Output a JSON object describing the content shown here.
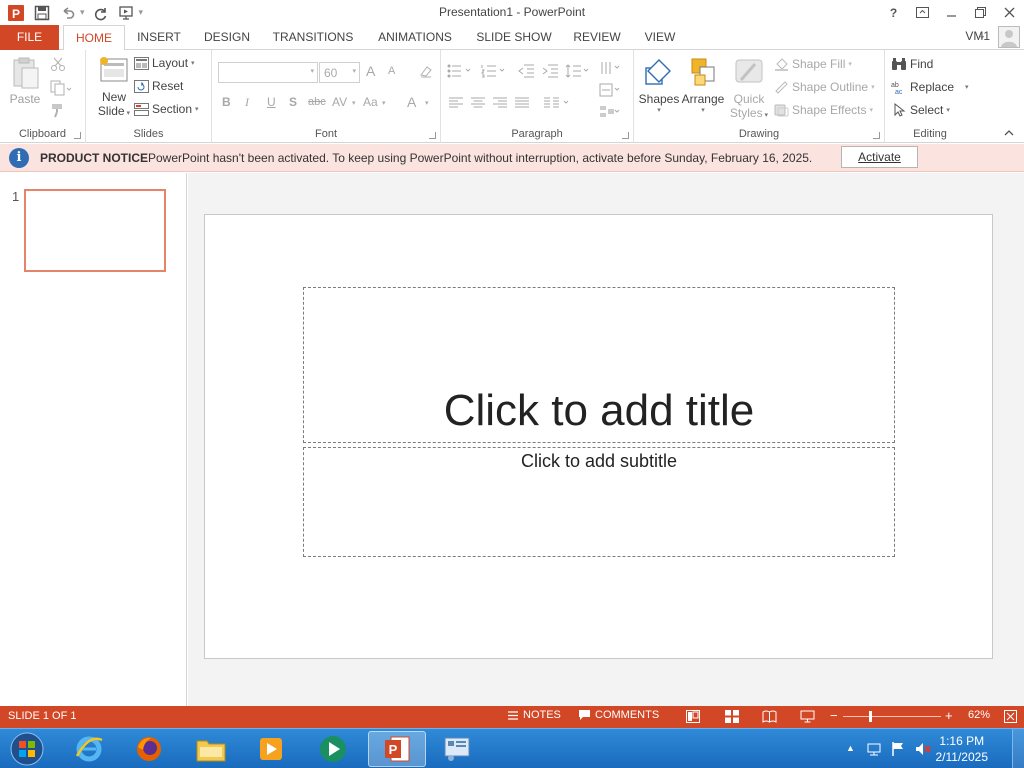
{
  "app": {
    "window_title": "Presentation1 - PowerPoint",
    "help_label": "?",
    "account_name": "VM1"
  },
  "tabs": [
    "FILE",
    "HOME",
    "INSERT",
    "DESIGN",
    "TRANSITIONS",
    "ANIMATIONS",
    "SLIDE SHOW",
    "REVIEW",
    "VIEW"
  ],
  "ribbon": {
    "clipboard": {
      "paste": "Paste",
      "group": "Clipboard"
    },
    "slides": {
      "new_slide_line1": "New",
      "new_slide_line2": "Slide",
      "layout": "Layout",
      "reset": "Reset",
      "section": "Section",
      "group": "Slides"
    },
    "font": {
      "font_size": "60",
      "bold": "B",
      "italic": "I",
      "underline": "U",
      "shadow": "S",
      "strike": "abc",
      "spacing": "AV",
      "case": "Aa",
      "color": "A",
      "grow": "A",
      "shrink": "A",
      "group": "Font"
    },
    "paragraph": {
      "group": "Paragraph"
    },
    "drawing": {
      "shapes": "Shapes",
      "arrange": "Arrange",
      "quick_line1": "Quick",
      "quick_line2": "Styles",
      "shape_fill": "Shape Fill",
      "shape_outline": "Shape Outline",
      "shape_effects": "Shape Effects",
      "group": "Drawing"
    },
    "editing": {
      "find": "Find",
      "replace": "Replace",
      "select": "Select",
      "group": "Editing"
    }
  },
  "notice": {
    "title": "PRODUCT NOTICE",
    "message": "PowerPoint hasn't been activated. To keep using PowerPoint without interruption, activate before Sunday, February 16, 2025.",
    "button": "Activate"
  },
  "slides_pane": {
    "slide_number": "1"
  },
  "slide": {
    "title_placeholder": "Click to add title",
    "subtitle_placeholder": "Click to add subtitle"
  },
  "status": {
    "slide_info": "SLIDE 1 OF 1",
    "notes": "NOTES",
    "comments": "COMMENTS",
    "zoom_minus": "−",
    "zoom_plus": "+",
    "zoom": "62%",
    "zoom_level_fraction": 0.28
  },
  "taskbar": {
    "time": "1:16 PM",
    "date": "2/11/2025"
  },
  "colors": {
    "accent": "#d24726",
    "notice_bg": "#fbe3e0",
    "taskbar": "#1a6bbd"
  }
}
